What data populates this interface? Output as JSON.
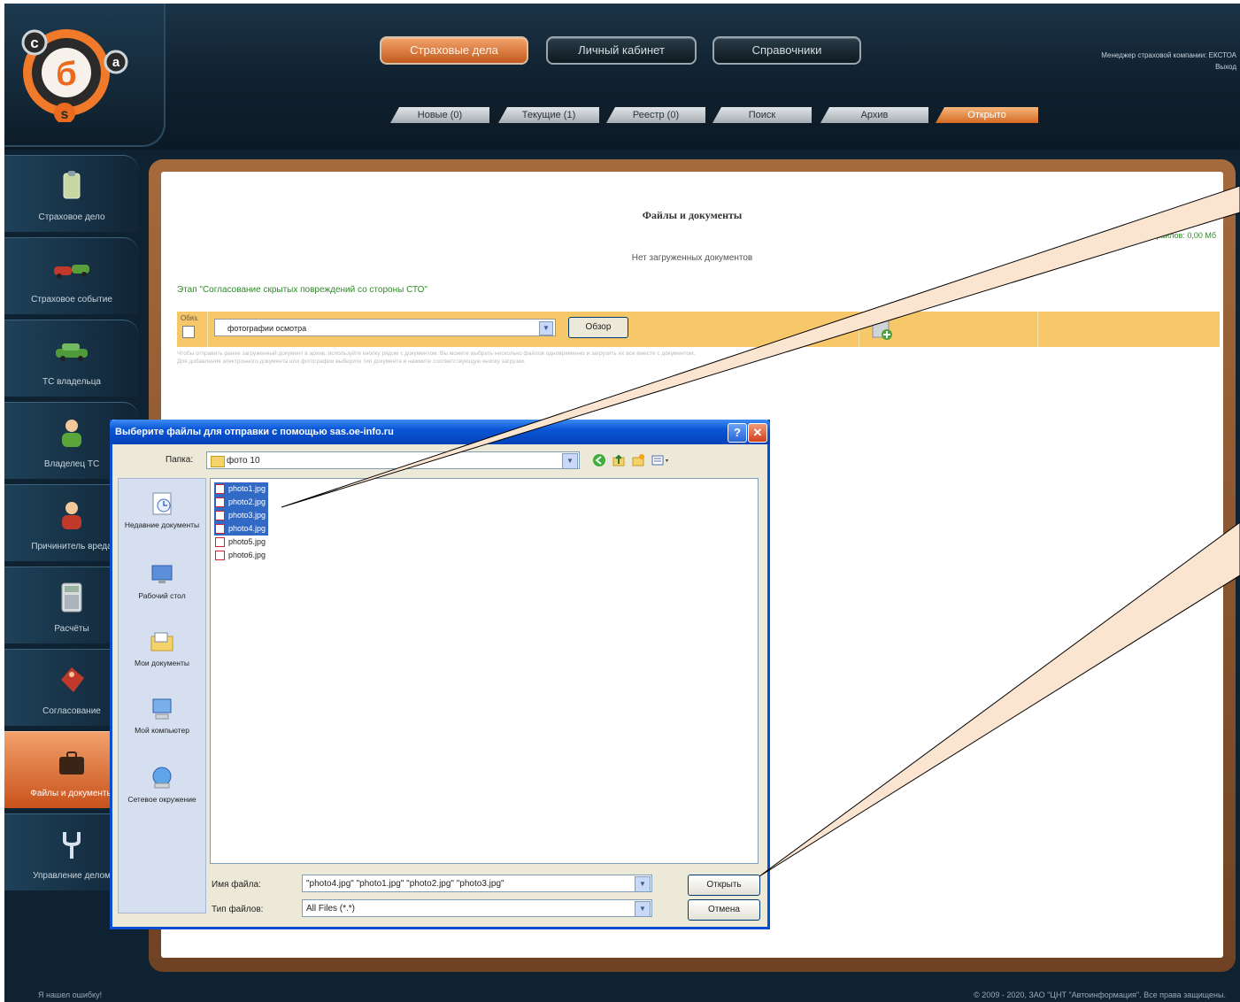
{
  "header": {
    "top_nav": [
      "Страховые дела",
      "Личный кабинет",
      "Справочники"
    ],
    "user_line1": "Менеджер страховой компании: ЕКСТОА",
    "user_line2": "Выход",
    "subtabs": [
      "Новые (0)",
      "Текущие (1)",
      "Реестр (0)",
      "Поиск",
      "Архив",
      "Открыто"
    ]
  },
  "sidebar": {
    "items": [
      {
        "label": "Страховое дело",
        "icon": "clipboard-icon"
      },
      {
        "label": "Страховое событие",
        "icon": "car-crash-icon"
      },
      {
        "label": "ТС владельца",
        "icon": "car-icon"
      },
      {
        "label": "Владелец ТС",
        "icon": "person-icon"
      },
      {
        "label": "Причинитель вреда",
        "icon": "person-red-icon"
      },
      {
        "label": "Расчёты",
        "icon": "calculator-icon"
      },
      {
        "label": "Согласование",
        "icon": "tag-icon"
      },
      {
        "label": "Файлы и документы",
        "icon": "briefcase-icon"
      },
      {
        "label": "Управление делом",
        "icon": "fork-icon"
      }
    ]
  },
  "content": {
    "title": "Файлы и документы",
    "files_size": "Объем файлов: 0,00 Мб",
    "no_docs": "Нет загруженных документов",
    "stage_title": "Этап \"Согласование скрытых повреждений со стороны СТО\"",
    "must_label": "Обяз.",
    "doc_type": "фотографии осмотра",
    "browse": "Обзор",
    "hint_line1": "Чтобы отправить ранее загруженный документ в архив, используйте кнопку рядом с документом. Вы можете выбрать несколько файлов одновременно и загрузить их все вместе с документом.",
    "hint_line2": "Для добавления электронного документа или фотографии выберите тип документа и нажмите соответствующую кнопку загрузки."
  },
  "footer": {
    "report_error": "Я нашел ошибку!",
    "copyright": "© 2009 - 2020, ЗАО \"ЦНТ \"Автоинформация\". Все права защищены."
  },
  "dialog": {
    "title": "Выберите файлы для отправки с помощью sas.oe-info.ru",
    "folder_label": "Папка:",
    "folder_value": "фото 10",
    "places": [
      "Недавние документы",
      "Рабочий стол",
      "Мои документы",
      "Мой компьютер",
      "Сетевое окружение"
    ],
    "files": [
      {
        "name": "photo1.jpg",
        "selected": true
      },
      {
        "name": "photo2.jpg",
        "selected": true
      },
      {
        "name": "photo3.jpg",
        "selected": true
      },
      {
        "name": "photo4.jpg",
        "selected": true
      },
      {
        "name": "photo5.jpg",
        "selected": false
      },
      {
        "name": "photo6.jpg",
        "selected": false
      }
    ],
    "filename_label": "Имя файла:",
    "filename_value": "\"photo4.jpg\" \"photo1.jpg\" \"photo2.jpg\" \"photo3.jpg\"",
    "filetype_label": "Тип файлов:",
    "filetype_value": "All Files (*.*)",
    "open": "Открыть",
    "cancel": "Отмена"
  }
}
